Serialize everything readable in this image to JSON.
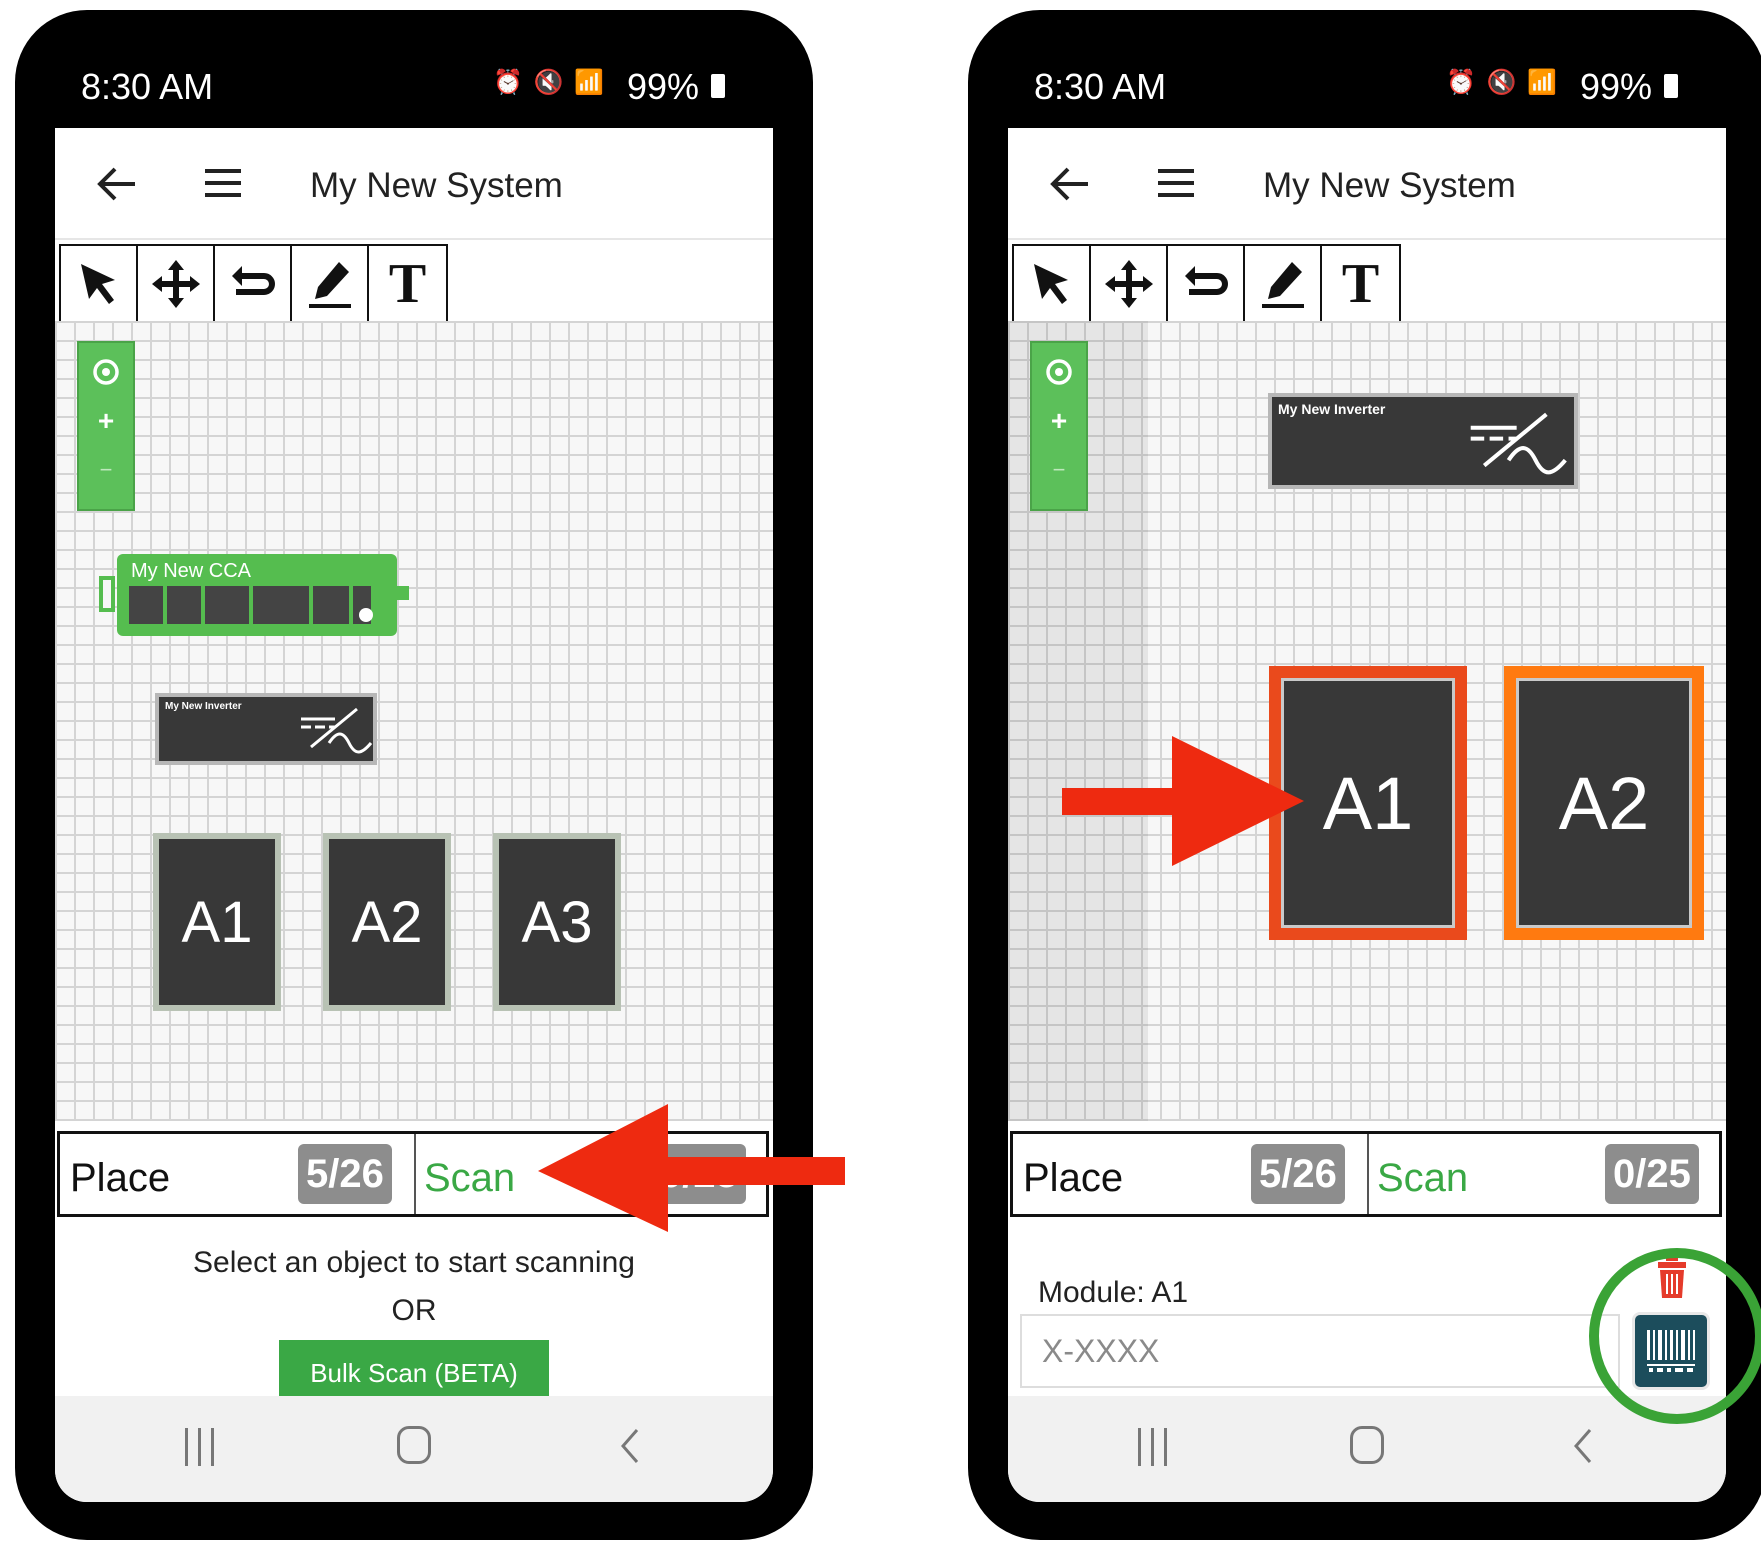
{
  "left": {
    "status": {
      "time": "8:30 AM",
      "battery": "99%",
      "icons": "⏰ 🔇 📶"
    },
    "appbar": {
      "title": "My New System"
    },
    "canvas": {
      "cca": {
        "label": "My New CCA"
      },
      "inverter": {
        "label": "My New Inverter"
      },
      "modules": [
        "A1",
        "A2",
        "A3"
      ]
    },
    "tabs": {
      "place_label": "Place",
      "place_count": "5/26",
      "scan_label": "Scan",
      "scan_count": "0/25"
    },
    "panel": {
      "hint": "Select an object to start scanning",
      "or": "OR",
      "bulk_button": "Bulk Scan (BETA)"
    }
  },
  "right": {
    "status": {
      "time": "8:30 AM",
      "battery": "99%",
      "icons": "⏰ 🔇 📶"
    },
    "appbar": {
      "title": "My New System"
    },
    "canvas": {
      "inverter": {
        "label": "My New Inverter"
      },
      "modules": [
        "A1",
        "A2"
      ]
    },
    "tabs": {
      "place_label": "Place",
      "place_count": "5/26",
      "scan_label": "Scan",
      "scan_count": "0/25"
    },
    "panel": {
      "module_label": "Module: A1",
      "serial_placeholder": "X-XXXX"
    }
  },
  "zoom_controls": {
    "plus": "+",
    "minus": "−",
    "center": "◎"
  },
  "toolbar_icons": [
    "select-arrow-icon",
    "move-icon",
    "undo-icon",
    "pencil-icon",
    "text-tool-icon"
  ],
  "colors": {
    "accent_green": "#3aa845",
    "callout_red": "#ee2a10",
    "highlight_orange": "#ff7a10",
    "highlight_red": "#ea4a1c",
    "circle_green": "#3aa336",
    "barcode_teal": "#1c4d5c"
  }
}
